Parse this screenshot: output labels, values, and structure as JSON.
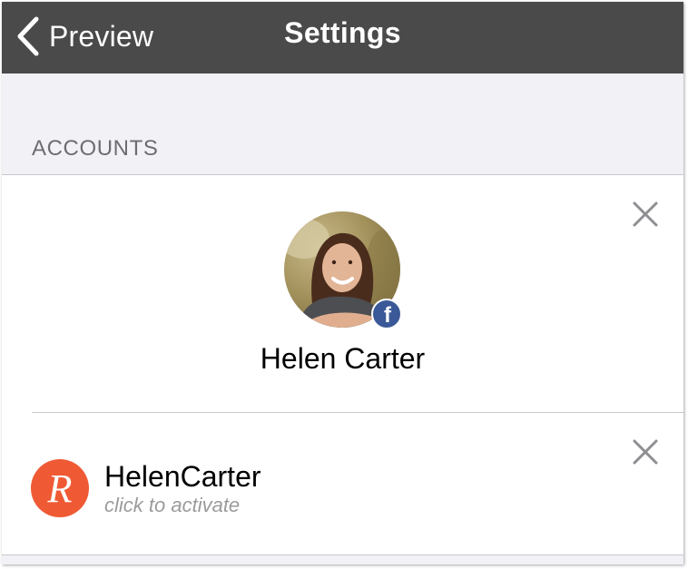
{
  "header": {
    "back_label": "Preview",
    "title": "Settings",
    "background": "#4a4a4a"
  },
  "accounts_section": {
    "header": "ACCOUNTS",
    "accounts": [
      {
        "provider_icon": "facebook-icon",
        "name": "Helen Carter",
        "badge_letter": "f",
        "badge_color": "#3b5998"
      },
      {
        "provider_icon": "r-app-logo-icon",
        "logo_letter": "R",
        "logo_color": "#ef5a35",
        "username": "HelenCarter",
        "hint": "click to activate"
      }
    ]
  }
}
